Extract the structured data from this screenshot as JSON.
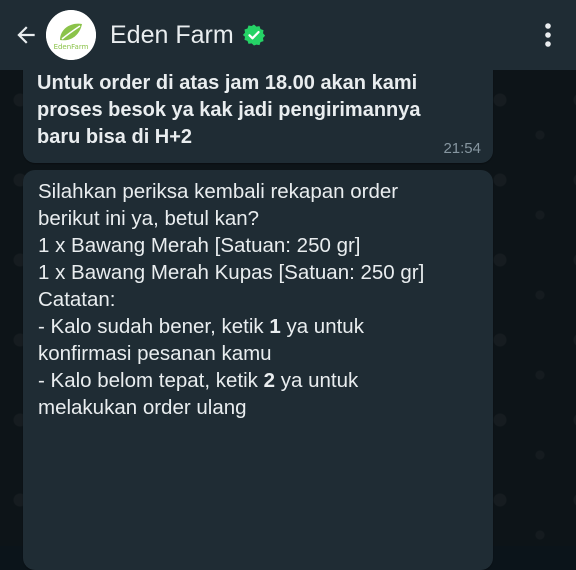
{
  "header": {
    "contact_name": "Eden Farm",
    "avatar_logo_text": "EdenFarm",
    "back_icon": "arrow-left-icon",
    "verified_icon": "verified-check-icon",
    "menu_icon": "more-vertical-icon"
  },
  "messages": [
    {
      "text_lines": [
        "Untuk order di atas jam 18.00 akan kami",
        "proses besok ya kak jadi pengirimannya",
        "baru bisa di H+2"
      ],
      "time": "21:54"
    },
    {
      "intro_lines": [
        "Silahkan periksa kembali rekapan order",
        "berikut ini ya, betul kan?"
      ],
      "items": [
        "1 x Bawang Merah [Satuan: 250 gr]",
        "1 x Bawang Merah Kupas [Satuan: 250 gr]"
      ],
      "notes_label": "Catatan:",
      "option1_pre": "- Kalo sudah bener, ketik ",
      "option1_num": "1",
      "option1_post": " ya untuk",
      "option1_cont": "konfirmasi pesanan kamu",
      "option2_pre": "- Kalo belom tepat, ketik ",
      "option2_num": "2",
      "option2_post": " ya untuk",
      "option2_cont": "melakukan order ulang"
    }
  ],
  "colors": {
    "header_bg": "#1f2c34",
    "bubble_bg": "#1f2c34",
    "text": "#e9edef",
    "time": "#8696a0",
    "verified": "#25d366"
  }
}
